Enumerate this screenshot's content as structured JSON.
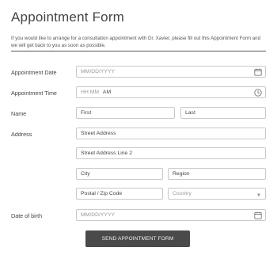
{
  "form": {
    "title": "Appointment Form",
    "description": "If you would like to arrange for a consultation appointment with Dr. Xavier, please fill out this Appointment Form and we will get back to you as soon as possible."
  },
  "appointment_date": {
    "label": "Appointment Date",
    "placeholder": "MM/DD/YYYY",
    "icon": "calendar-icon"
  },
  "appointment_time": {
    "label": "Appointment Time",
    "placeholder": "HH:MM",
    "ampm": "AM",
    "icon": "clock-icon"
  },
  "name": {
    "label": "Name",
    "first_placeholder": "First",
    "last_placeholder": "Last"
  },
  "address": {
    "label": "Address",
    "street_placeholder": "Street Address",
    "street2_placeholder": "Street Address Line 2",
    "city_placeholder": "City",
    "region_placeholder": "Region",
    "postal_placeholder": "Postal / Zip Code",
    "country_placeholder": "Country"
  },
  "date_of_birth": {
    "label": "Date of birth",
    "placeholder": "MM/DD/YYYY",
    "icon": "calendar-icon"
  },
  "submit": {
    "label": "SEND APPOINTMENT FORM",
    "color": "#4a4a4a"
  }
}
